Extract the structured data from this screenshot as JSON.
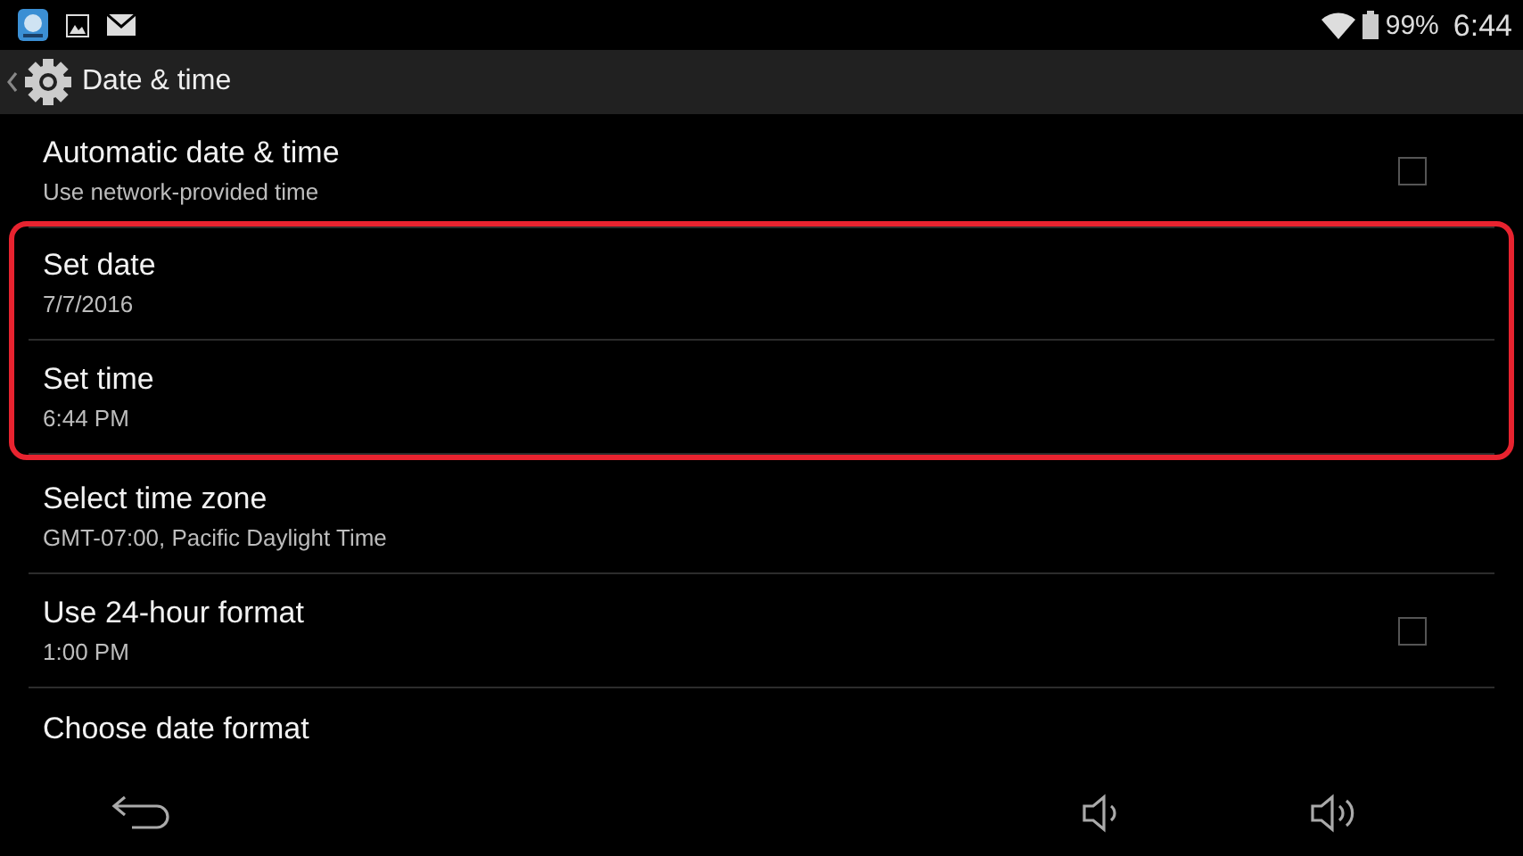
{
  "status_bar": {
    "battery": "99%",
    "time": "6:44"
  },
  "action_bar": {
    "title": "Date & time"
  },
  "settings": [
    {
      "title": "Automatic date & time",
      "summary": "Use network-provided time",
      "kind": "checkbox",
      "checked": false,
      "highlighted": false
    },
    {
      "title": "Set date",
      "summary": "7/7/2016",
      "kind": "plain",
      "highlighted": true
    },
    {
      "title": "Set time",
      "summary": "6:44 PM",
      "kind": "plain",
      "highlighted": true
    },
    {
      "title": "Select time zone",
      "summary": "GMT-07:00, Pacific Daylight Time",
      "kind": "plain",
      "highlighted": false
    },
    {
      "title": "Use 24-hour format",
      "summary": "1:00 PM",
      "kind": "checkbox",
      "checked": false,
      "highlighted": false
    },
    {
      "title": "Choose date format",
      "kind": "plain",
      "highlighted": false
    }
  ]
}
